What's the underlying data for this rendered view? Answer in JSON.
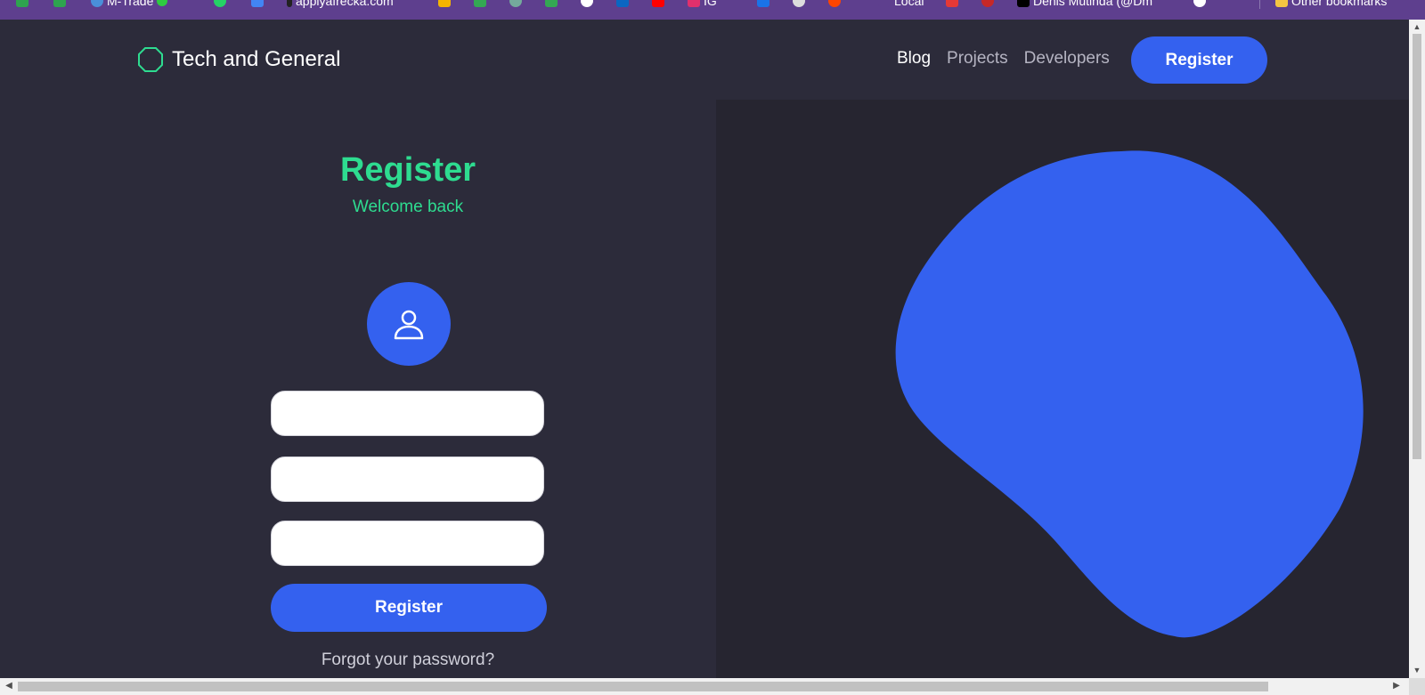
{
  "bookmarks": [
    {
      "label": "",
      "icon": "green-square-icon",
      "color": "#2ea44f"
    },
    {
      "label": "",
      "icon": "green-square-icon",
      "color": "#2ea44f"
    },
    {
      "label": "M-Trade",
      "icon": "circle-icon",
      "color": "#4a90d9"
    },
    {
      "label": "",
      "icon": "whatsapp-icon",
      "color": "#25d366"
    },
    {
      "label": "",
      "icon": "app-icon",
      "color": "#4285f4"
    },
    {
      "label": "applyafrecka.com",
      "icon": "mic-icon",
      "color": "#222222"
    },
    {
      "label": "",
      "icon": "folder-icon",
      "color": "#f4b400"
    },
    {
      "label": "",
      "icon": "maps-icon",
      "color": "#34a853"
    },
    {
      "label": "",
      "icon": "chatgpt-icon",
      "color": "#74aa9c"
    },
    {
      "label": "",
      "icon": "pin-icon",
      "color": "#34a853"
    },
    {
      "label": "",
      "icon": "github-icon",
      "color": "#ffffff"
    },
    {
      "label": "",
      "icon": "linkedin-icon",
      "color": "#0a66c2"
    },
    {
      "label": "",
      "icon": "youtube-icon",
      "color": "#ff0000"
    },
    {
      "label": "IG",
      "icon": "instagram-icon",
      "color": "#e1306c"
    },
    {
      "label": "",
      "icon": "shield-icon",
      "color": "#1a73e8"
    },
    {
      "label": "",
      "icon": "drop-icon",
      "color": "#dddddd"
    },
    {
      "label": "",
      "icon": "reddit-icon",
      "color": "#ff4500"
    },
    {
      "label": "Local",
      "icon": "dot-icon",
      "color": "#5e3f8e"
    },
    {
      "label": "",
      "icon": "x-red-icon",
      "color": "#e53935"
    },
    {
      "label": "",
      "icon": "c-red-icon",
      "color": "#c62828"
    },
    {
      "label": "Denis Mutinda (@Dm",
      "icon": "x-logo-icon",
      "color": "#000000"
    },
    {
      "label": "",
      "icon": "avatar-icon",
      "color": "#ffffff"
    },
    {
      "label": "Other bookmarks",
      "icon": "folder-icon",
      "color": "#f4c542"
    }
  ],
  "nav": {
    "brand": "Tech and General",
    "links": [
      "Blog",
      "Projects",
      "Developers"
    ],
    "active_link": "Blog",
    "cta": "Register"
  },
  "form": {
    "title": "Register",
    "subtitle": "Welcome back",
    "fields": [
      {
        "value": "",
        "placeholder": ""
      },
      {
        "value": "",
        "placeholder": ""
      },
      {
        "value": "",
        "placeholder": ""
      }
    ],
    "submit": "Register",
    "forgot": "Forgot your password?"
  },
  "colors": {
    "background": "#2c2b3a",
    "panel": "#262530",
    "accent_blue": "#3461ef",
    "accent_green": "#2edc90",
    "bookmarks_bar": "#5e3f8e"
  }
}
